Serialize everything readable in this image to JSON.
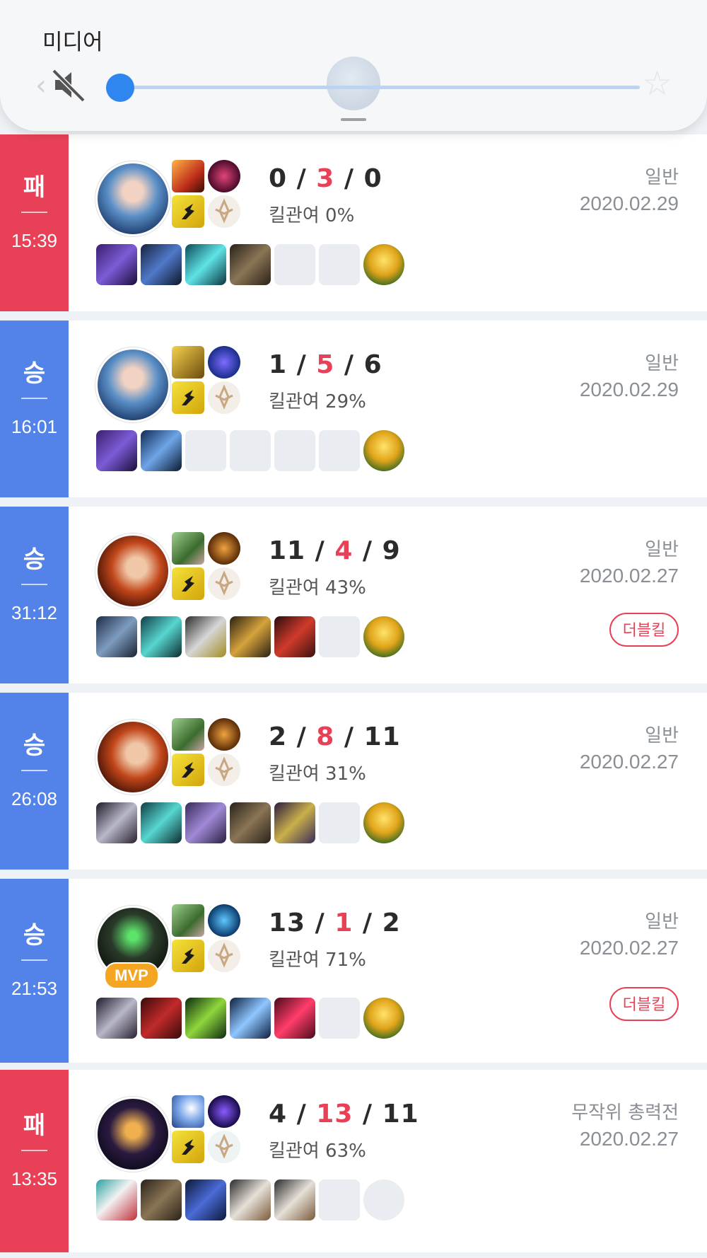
{
  "media_panel": {
    "title": "미디어",
    "volume_level": 0
  },
  "colors": {
    "lose": "#e84057",
    "win": "#5383e8",
    "death": "#e84057",
    "accent": "#2f86ee"
  },
  "matches": [
    {
      "result": "패",
      "result_type": "lose",
      "duration": "15:39",
      "kills": "0",
      "deaths": "3",
      "assists": "0",
      "kill_participation": "킬관여 0%",
      "mode": "일반",
      "date": "2020.02.29",
      "badge": "",
      "mvp": "",
      "spells": [
        "flame-spell-icon",
        "dark-orb-spell-icon"
      ],
      "runes": [
        "flash-rune-icon",
        "precision-rune-icon"
      ],
      "items": [
        "crystal-spear-icon",
        "blue-sword-icon",
        "spirit-icon",
        "boots-icon",
        "empty-slot",
        "empty-slot"
      ],
      "ward": "trinket-icon"
    },
    {
      "result": "승",
      "result_type": "win",
      "duration": "16:01",
      "kills": "1",
      "deaths": "5",
      "assists": "6",
      "kill_participation": "킬관여 29%",
      "mode": "일반",
      "date": "2020.02.29",
      "badge": "",
      "mvp": "",
      "spells": [
        "golden-knight-spell-icon",
        "blue-swirl-spell-icon"
      ],
      "runes": [
        "flash-rune-icon",
        "precision-rune-icon"
      ],
      "items": [
        "crystal-spear-icon",
        "blue-gauntlet-icon",
        "empty-slot",
        "empty-slot",
        "empty-slot",
        "empty-slot"
      ],
      "ward": "trinket-icon"
    },
    {
      "result": "승",
      "result_type": "win",
      "duration": "31:12",
      "kills": "11",
      "deaths": "4",
      "assists": "9",
      "kill_participation": "킬관여 43%",
      "mode": "일반",
      "date": "2020.02.27",
      "badge": "더블킬",
      "mvp": "",
      "spells": [
        "hooded-spell-icon",
        "sun-rune-spell-icon"
      ],
      "runes": [
        "flash-rune-icon",
        "domination-rune-icon"
      ],
      "items": [
        "chainmail-icon",
        "teal-blade-icon",
        "gunblade-icon",
        "golden-spear-icon",
        "red-axe-icon",
        "empty-slot"
      ],
      "ward": "trinket-icon"
    },
    {
      "result": "승",
      "result_type": "win",
      "duration": "26:08",
      "kills": "2",
      "deaths": "8",
      "assists": "11",
      "kill_participation": "킬관여 31%",
      "mode": "일반",
      "date": "2020.02.27",
      "badge": "",
      "mvp": "",
      "spells": [
        "hooded-spell-icon",
        "sun-rune-spell-icon"
      ],
      "runes": [
        "flash-rune-icon",
        "domination-rune-icon"
      ],
      "items": [
        "long-sword-icon",
        "teal-blade-icon",
        "violet-claw-icon",
        "boots-icon",
        "purple-sword-icon",
        "empty-slot"
      ],
      "ward": "trinket-icon"
    },
    {
      "result": "승",
      "result_type": "win",
      "duration": "21:53",
      "kills": "13",
      "deaths": "1",
      "assists": "2",
      "kill_participation": "킬관여 71%",
      "mode": "일반",
      "date": "2020.02.27",
      "badge": "더블킬",
      "mvp": "MVP",
      "spells": [
        "hooded-spell-icon",
        "blue-crystal-spell-icon"
      ],
      "runes": [
        "flash-rune-icon",
        "precision-rune-icon"
      ],
      "items": [
        "long-sword-icon",
        "crimson-blade-icon",
        "green-gun-icon",
        "blue-trident-icon",
        "ruby-icon",
        "empty-slot"
      ],
      "ward": "trinket-icon"
    },
    {
      "result": "패",
      "result_type": "lose",
      "duration": "13:35",
      "kills": "4",
      "deaths": "13",
      "assists": "11",
      "kill_participation": "킬관여 63%",
      "mode": "무작위 총력전",
      "date": "2020.02.27",
      "badge": "",
      "mvp": "",
      "spells": [
        "snowball-spell-icon",
        "purple-flame-spell-icon"
      ],
      "runes": [
        "flash-rune-icon",
        "resolve-rune-icon"
      ],
      "items": [
        "masked-girl-icon",
        "boots-icon",
        "dark-armor-icon",
        "white-vest-icon",
        "white-vest-icon",
        "empty-slot"
      ],
      "ward": "empty-slot"
    }
  ]
}
